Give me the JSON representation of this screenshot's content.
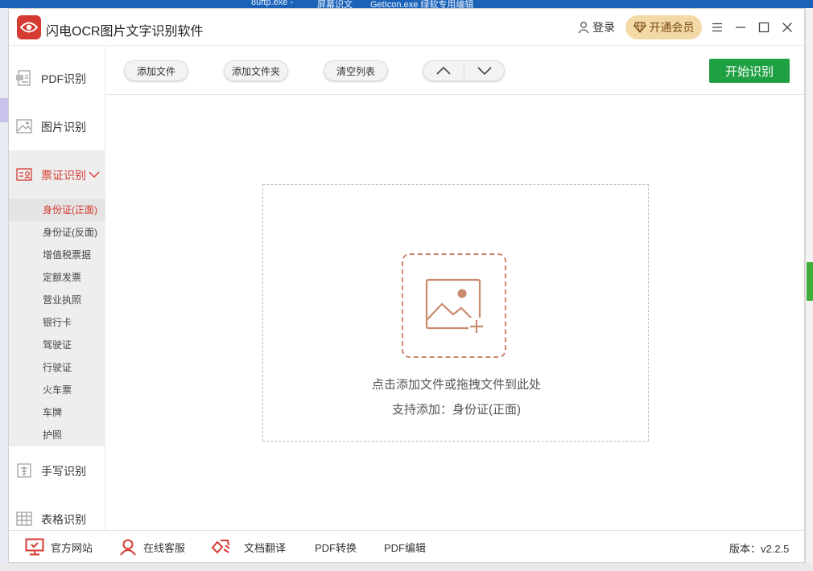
{
  "taskbar": {
    "items": [
      "8uftp.exe -",
      "屏幕识文",
      "GetIcon.exe  绿软专用编辑"
    ]
  },
  "titlebar": {
    "app_title": "闪电OCR图片文字识别软件",
    "login_label": "登录",
    "vip_label": "开通会员"
  },
  "sidebar": {
    "items": [
      {
        "label": "PDF识别",
        "icon": "pdf-icon"
      },
      {
        "label": "图片识别",
        "icon": "image-icon"
      },
      {
        "label": "票证识别",
        "icon": "id-card-icon"
      },
      {
        "label": "手写识别",
        "icon": "handwriting-icon"
      },
      {
        "label": "表格识别",
        "icon": "table-icon"
      }
    ],
    "submenu": [
      "身份证(正面)",
      "身份证(反面)",
      "增值税票据",
      "定额发票",
      "营业执照",
      "银行卡",
      "驾驶证",
      "行驶证",
      "火车票",
      "车牌",
      "护照"
    ],
    "active_sub": "身份证(正面)"
  },
  "toolbar": {
    "add_file": "添加文件",
    "add_folder": "添加文件夹",
    "clear_list": "清空列表",
    "start": "开始识别"
  },
  "dropzone": {
    "hint": "点击添加文件或拖拽文件到此处",
    "support": "支持添加：身份证(正面)"
  },
  "footer": {
    "website": "官方网站",
    "service": "在线客服",
    "translate": "文档翻译",
    "pdf_convert": "PDF转换",
    "pdf_edit": "PDF编辑",
    "version": "版本：v2.2.5"
  },
  "colors": {
    "accent_red": "#d63a32",
    "start_green": "#1fa043",
    "vip_gold": "#f3d9a6"
  }
}
